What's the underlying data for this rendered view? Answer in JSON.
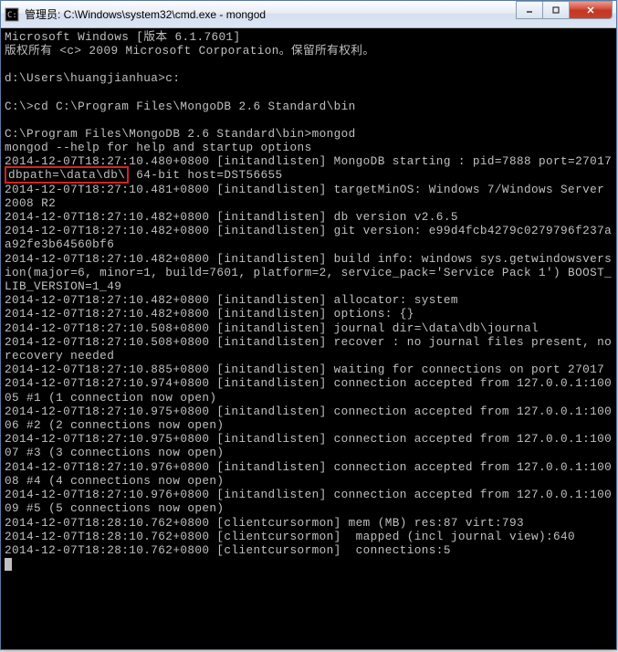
{
  "window": {
    "title": "管理员: C:\\Windows\\system32\\cmd.exe - mongod"
  },
  "terminal": {
    "line1": "Microsoft Windows [版本 6.1.7601]",
    "line2": "版权所有 <c> 2009 Microsoft Corporation。保留所有权利。",
    "line3": "d:\\Users\\huangjianhua>c:",
    "line4": "C:\\>cd C:\\Program Files\\MongoDB 2.6 Standard\\bin",
    "line5": "C:\\Program Files\\MongoDB 2.6 Standard\\bin>mongod",
    "line6": "mongod --help for help and startup options",
    "line7a": "2014-12-07T18:27:10.480+0800 [initandlisten] MongoDB starting : pid=7888 port=27017 ",
    "line7_highlight": "dbpath=\\data\\db\\",
    "line7b": " 64-bit host=DST56655",
    "line8": "2014-12-07T18:27:10.481+0800 [initandlisten] targetMinOS: Windows 7/Windows Server 2008 R2",
    "line9": "2014-12-07T18:27:10.482+0800 [initandlisten] db version v2.6.5",
    "line10": "2014-12-07T18:27:10.482+0800 [initandlisten] git version: e99d4fcb4279c0279796f237aa92fe3b64560bf6",
    "line11": "2014-12-07T18:27:10.482+0800 [initandlisten] build info: windows sys.getwindowsversion(major=6, minor=1, build=7601, platform=2, service_pack='Service Pack 1') BOOST_LIB_VERSION=1_49",
    "line12": "2014-12-07T18:27:10.482+0800 [initandlisten] allocator: system",
    "line13": "2014-12-07T18:27:10.482+0800 [initandlisten] options: {}",
    "line14": "2014-12-07T18:27:10.508+0800 [initandlisten] journal dir=\\data\\db\\journal",
    "line15": "2014-12-07T18:27:10.508+0800 [initandlisten] recover : no journal files present, no recovery needed",
    "line16": "2014-12-07T18:27:10.885+0800 [initandlisten] waiting for connections on port 27017",
    "line17": "2014-12-07T18:27:10.974+0800 [initandlisten] connection accepted from 127.0.0.1:10005 #1 (1 connection now open)",
    "line18": "2014-12-07T18:27:10.975+0800 [initandlisten] connection accepted from 127.0.0.1:10006 #2 (2 connections now open)",
    "line19": "2014-12-07T18:27:10.975+0800 [initandlisten] connection accepted from 127.0.0.1:10007 #3 (3 connections now open)",
    "line20": "2014-12-07T18:27:10.976+0800 [initandlisten] connection accepted from 127.0.0.1:10008 #4 (4 connections now open)",
    "line21": "2014-12-07T18:27:10.976+0800 [initandlisten] connection accepted from 127.0.0.1:10009 #5 (5 connections now open)",
    "line22": "2014-12-07T18:28:10.762+0800 [clientcursormon] mem (MB) res:87 virt:793",
    "line23": "2014-12-07T18:28:10.762+0800 [clientcursormon]  mapped (incl journal view):640",
    "line24": "2014-12-07T18:28:10.762+0800 [clientcursormon]  connections:5"
  }
}
